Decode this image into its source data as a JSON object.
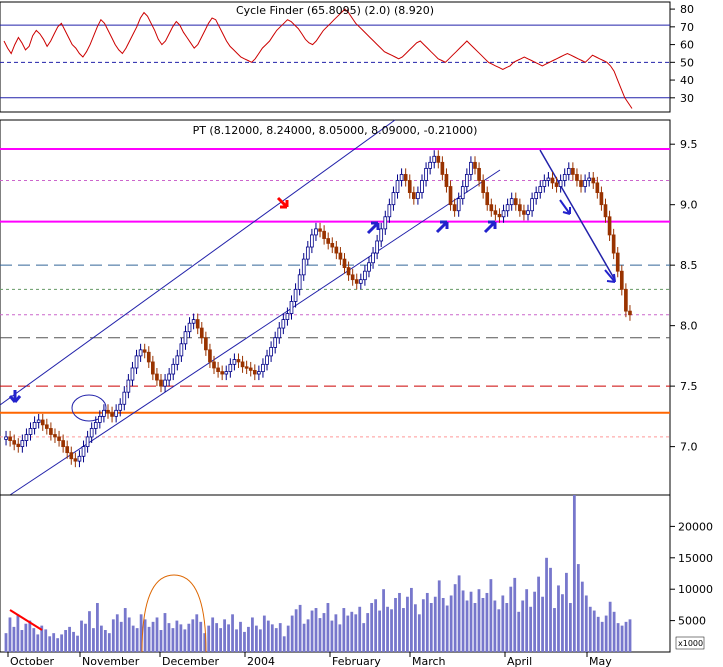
{
  "chart_data": [
    {
      "panel": "indicator",
      "type": "line",
      "title": "Cycle Finder (65.8095) (2.0) (8.920)",
      "yticks": [
        30,
        40,
        50,
        60,
        70,
        80
      ],
      "ylim": [
        22,
        84
      ],
      "reference_lines": [
        {
          "value": 71,
          "style": "solid"
        },
        {
          "value": 50,
          "style": "dashed"
        },
        {
          "value": 30,
          "style": "solid"
        }
      ],
      "series": [
        {
          "color": "#cc0000",
          "values": [
            62,
            58,
            55,
            60,
            64,
            61,
            57,
            59,
            65,
            68,
            66,
            63,
            59,
            62,
            66,
            70,
            72,
            68,
            64,
            60,
            58,
            55,
            53,
            56,
            60,
            65,
            70,
            74,
            72,
            68,
            64,
            60,
            57,
            55,
            58,
            62,
            66,
            70,
            75,
            78,
            76,
            72,
            68,
            63,
            60,
            62,
            66,
            70,
            73,
            71,
            67,
            64,
            61,
            58,
            60,
            64,
            68,
            72,
            75,
            74,
            70,
            66,
            62,
            59,
            57,
            55,
            53,
            52,
            51,
            50,
            52,
            55,
            58,
            60,
            62,
            65,
            68,
            70,
            72,
            74,
            73,
            71,
            69,
            66,
            63,
            61,
            60,
            62,
            65,
            68,
            70,
            72,
            74,
            76,
            78,
            80,
            78,
            75,
            72,
            70,
            68,
            66,
            64,
            62,
            60,
            58,
            56,
            55,
            54,
            53,
            52,
            53,
            55,
            57,
            59,
            61,
            62,
            60,
            58,
            56,
            54,
            52,
            51,
            50,
            52,
            54,
            56,
            58,
            60,
            62,
            60,
            58,
            56,
            54,
            52,
            50,
            49,
            48,
            47,
            46,
            47,
            48,
            50,
            51,
            52,
            53,
            52,
            51,
            50,
            49,
            48,
            49,
            50,
            51,
            52,
            53,
            54,
            55,
            54,
            53,
            52,
            51,
            50,
            52,
            54,
            53,
            52,
            51,
            50,
            48,
            45,
            40,
            35,
            30,
            27,
            24
          ]
        }
      ]
    },
    {
      "panel": "price",
      "type": "candlestick",
      "title": "PT (8.12000, 8.24000, 8.05000, 8.09000, -0.21000)",
      "ylim": [
        6.6,
        9.7
      ],
      "yticks": [
        7.0,
        7.5,
        8.0,
        8.5,
        9.0,
        9.5
      ],
      "x_tick_labels": [
        "October",
        "November",
        "December",
        "2004",
        "February",
        "March",
        "April",
        "May"
      ],
      "last_close": 8.09,
      "closes": [
        7.08,
        7.05,
        7.02,
        7.0,
        7.05,
        7.1,
        7.15,
        7.2,
        7.22,
        7.18,
        7.15,
        7.1,
        7.08,
        7.05,
        7.0,
        6.95,
        6.9,
        6.88,
        6.92,
        7.0,
        7.08,
        7.15,
        7.2,
        7.25,
        7.3,
        7.28,
        7.25,
        7.3,
        7.35,
        7.45,
        7.55,
        7.65,
        7.75,
        7.8,
        7.78,
        7.7,
        7.6,
        7.55,
        7.5,
        7.55,
        7.6,
        7.68,
        7.75,
        7.85,
        7.95,
        8.02,
        8.05,
        7.98,
        7.9,
        7.8,
        7.7,
        7.65,
        7.62,
        7.6,
        7.62,
        7.68,
        7.72,
        7.7,
        7.66,
        7.65,
        7.63,
        7.6,
        7.62,
        7.68,
        7.75,
        7.82,
        7.9,
        7.98,
        8.05,
        8.1,
        8.2,
        8.3,
        8.42,
        8.55,
        8.65,
        8.75,
        8.8,
        8.78,
        8.72,
        8.68,
        8.65,
        8.6,
        8.55,
        8.48,
        8.42,
        8.38,
        8.35,
        8.38,
        8.45,
        8.52,
        8.6,
        8.7,
        8.8,
        8.9,
        9.0,
        9.1,
        9.2,
        9.25,
        9.2,
        9.1,
        9.05,
        9.1,
        9.2,
        9.3,
        9.35,
        9.4,
        9.35,
        9.25,
        9.15,
        9.0,
        8.95,
        9.05,
        9.15,
        9.25,
        9.35,
        9.3,
        9.2,
        9.1,
        9.0,
        8.95,
        8.92,
        8.9,
        8.95,
        9.0,
        9.05,
        9.0,
        8.95,
        8.92,
        8.95,
        9.05,
        9.1,
        9.15,
        9.2,
        9.22,
        9.18,
        9.15,
        9.2,
        9.25,
        9.3,
        9.25,
        9.2,
        9.15,
        9.2,
        9.22,
        9.18,
        9.1,
        9.0,
        8.9,
        8.75,
        8.6,
        8.45,
        8.3,
        8.12,
        8.09
      ],
      "reference_lines": [
        {
          "value": 9.46,
          "color": "#ff00ff",
          "style": "solid"
        },
        {
          "value": 9.2,
          "color": "#cc66cc",
          "style": "dashed"
        },
        {
          "value": 8.86,
          "color": "#ff00ff",
          "style": "solid"
        },
        {
          "value": 8.5,
          "color": "#336699",
          "style": "long-dash"
        },
        {
          "value": 8.3,
          "color": "#669966",
          "style": "dashed"
        },
        {
          "value": 8.09,
          "color": "#cc66cc",
          "style": "dashed"
        },
        {
          "value": 7.9,
          "color": "#555555",
          "style": "long-dash"
        },
        {
          "value": 7.5,
          "color": "#cc0000",
          "style": "long-dash"
        },
        {
          "value": 7.28,
          "color": "#ff6600",
          "style": "solid"
        },
        {
          "value": 7.08,
          "color": "#ff9999",
          "style": "dashed"
        }
      ]
    },
    {
      "panel": "volume",
      "type": "bar",
      "yticks": [
        5000,
        10000,
        15000,
        20000
      ],
      "ylim": [
        0,
        25000
      ],
      "scale_label": "x1000",
      "color": "#7777cc",
      "values": [
        3000,
        5500,
        4000,
        6000,
        3500,
        4500,
        5000,
        3800,
        2800,
        4200,
        3600,
        2500,
        3000,
        2200,
        2800,
        3500,
        4000,
        3200,
        2600,
        5000,
        4500,
        6500,
        3800,
        7800,
        4200,
        3500,
        3000,
        5200,
        6000,
        4800,
        7000,
        5500,
        4200,
        3800,
        6000,
        5200,
        4000,
        4800,
        5500,
        3500,
        6200,
        4600,
        3800,
        5000,
        4400,
        3600,
        4500,
        5200,
        6000,
        4800,
        3000,
        4200,
        5500,
        4600,
        3800,
        5200,
        4400,
        6000,
        3600,
        4800,
        3200,
        4000,
        5500,
        4200,
        3600,
        5800,
        5000,
        4400,
        3800,
        4600,
        2500,
        4200,
        5800,
        6800,
        7500,
        4500,
        5200,
        6600,
        7000,
        5400,
        6200,
        7800,
        5000,
        6000,
        4400,
        7000,
        5800,
        6400,
        6000,
        7200,
        4600,
        6200,
        7800,
        8400,
        6600,
        10000,
        7200,
        6800,
        8600,
        9400,
        7000,
        8800,
        10200,
        7600,
        6000,
        8400,
        9400,
        7800,
        8800,
        11400,
        8600,
        7400,
        9000,
        10800,
        12200,
        9800,
        8200,
        9600,
        7800,
        10000,
        8600,
        9400,
        11600,
        8200,
        6800,
        9000,
        7800,
        10400,
        11800,
        6400,
        8200,
        10000,
        7200,
        9600,
        12000,
        8800,
        15000,
        13400,
        7000,
        10600,
        9200,
        12600,
        7800,
        25000,
        14000,
        11200,
        9000,
        7200,
        6600,
        5600,
        4800,
        5800,
        8000,
        6400,
        4600,
        4200,
        4800,
        5200
      ]
    }
  ],
  "x_tick_labels": [
    "October",
    "November",
    "December",
    "2004",
    "February",
    "March",
    "April",
    "May"
  ]
}
